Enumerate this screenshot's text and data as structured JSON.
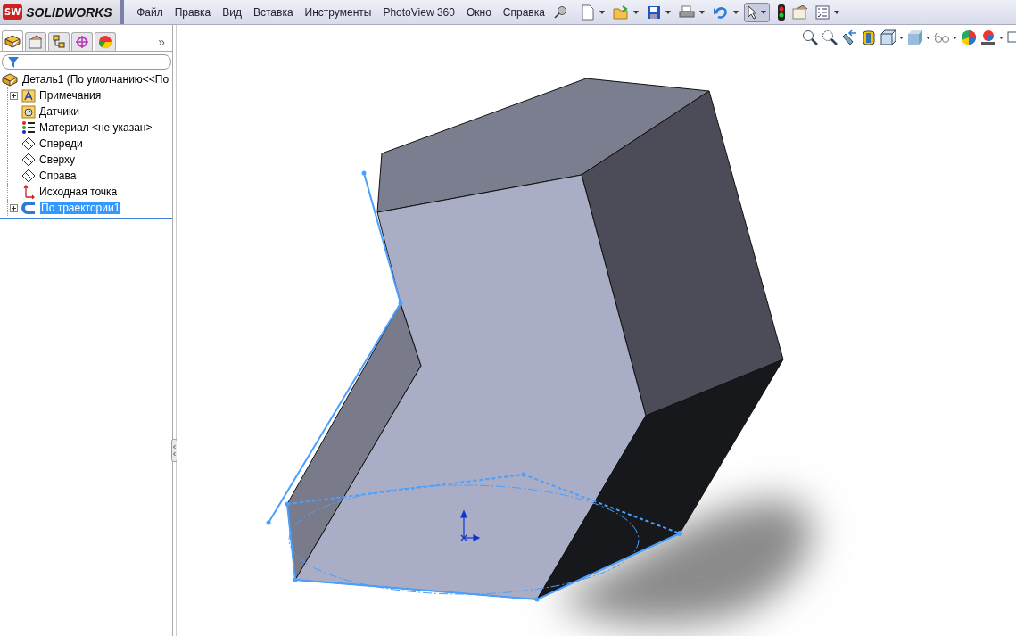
{
  "app": {
    "name_light": "SOLID",
    "name_bold": "WORKS",
    "logo": "SW"
  },
  "menu": [
    {
      "label": "Файл"
    },
    {
      "label": "Правка"
    },
    {
      "label": "Вид"
    },
    {
      "label": "Вставка"
    },
    {
      "label": "Инструменты"
    },
    {
      "label": "PhotoView 360"
    },
    {
      "label": "Окно"
    },
    {
      "label": "Справка"
    }
  ],
  "panel_tabs": [
    {
      "kind": "tree",
      "selected": true
    },
    {
      "kind": "properties",
      "selected": false
    },
    {
      "kind": "config",
      "selected": false
    },
    {
      "kind": "target",
      "selected": false
    },
    {
      "kind": "appearance",
      "selected": false
    }
  ],
  "panel_more": "»",
  "tree": [
    {
      "kind": "part",
      "label": "Деталь1  (По умолчанию<<По",
      "expandable": false,
      "selected": false
    },
    {
      "kind": "notes",
      "label": "Примечания",
      "expandable": true,
      "selected": false
    },
    {
      "kind": "sensors",
      "label": "Датчики",
      "expandable": false,
      "selected": false
    },
    {
      "kind": "material",
      "label": "Материал <не указан>",
      "expandable": false,
      "selected": false
    },
    {
      "kind": "plane",
      "label": "Спереди",
      "expandable": false,
      "selected": false
    },
    {
      "kind": "plane",
      "label": "Сверху",
      "expandable": false,
      "selected": false
    },
    {
      "kind": "plane",
      "label": "Справа",
      "expandable": false,
      "selected": false
    },
    {
      "kind": "origin",
      "label": "Исходная точка",
      "expandable": false,
      "selected": false
    },
    {
      "kind": "sweep",
      "label": "По траектории1",
      "expandable": true,
      "selected": true
    }
  ]
}
